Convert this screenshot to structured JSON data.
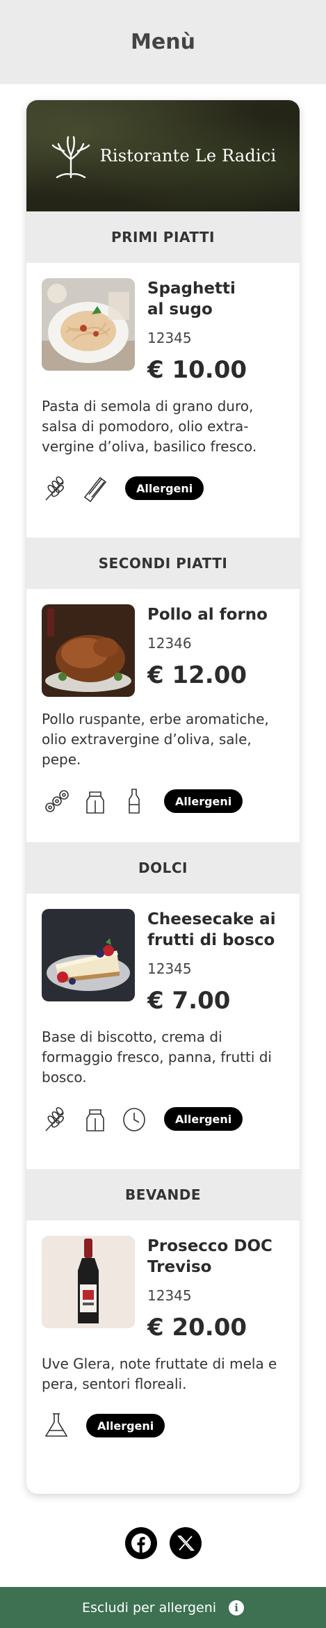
{
  "header": {
    "title": "Menù"
  },
  "restaurant": {
    "name": "Ristorante Le Radici"
  },
  "allergens_label": "Allergeni",
  "sections": [
    {
      "title": "PRIMI PIATTI",
      "item": {
        "name_lines": [
          "Spaghetti",
          "al sugo"
        ],
        "code": "12345",
        "price": "€ 10.00",
        "description": "Pasta di semola di grano duro, salsa di pomodoro, olio extra-vergine d’oliva, basilico fresco.",
        "allergen_icons": [
          "wheat-icon",
          "celery-icon"
        ]
      }
    },
    {
      "title": "SECONDI PIATTI",
      "item": {
        "name_lines": [
          "Pollo al forno"
        ],
        "code": "12346",
        "price": "€ 12.00",
        "description": "Pollo ruspante, erbe aromatiche, olio extravergine d’oliva, sale, pepe.",
        "allergen_icons": [
          "lupin-icon",
          "milk-icon",
          "mustard-icon"
        ]
      }
    },
    {
      "title": "DOLCI",
      "item": {
        "name_lines": [
          "Cheesecake ai",
          "frutti di bosco"
        ],
        "code": "12345",
        "price": "€ 7.00",
        "description": "Base di biscotto, crema di formaggio fresco, panna, frutti di bosco.",
        "allergen_icons": [
          "wheat-icon",
          "milk-icon",
          "egg-icon"
        ]
      }
    },
    {
      "title": "BEVANDE",
      "item": {
        "name_lines": [
          "Prosecco DOC",
          "Treviso"
        ],
        "code": "12345",
        "price": "€ 20.00",
        "description": "Uve Glera, note fruttate di mela e pera, sentori floreali.",
        "allergen_icons": [
          "sulphites-icon"
        ]
      }
    }
  ],
  "social": [
    "facebook-icon",
    "x-icon"
  ],
  "footer": {
    "label": "Escludi per allergeni"
  }
}
